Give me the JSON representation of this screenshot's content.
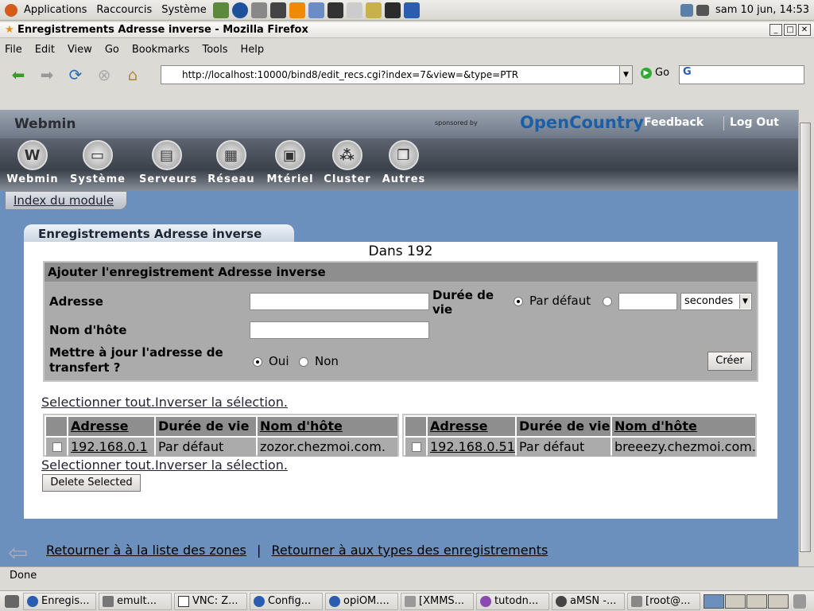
{
  "panel": {
    "menus": [
      "Applications",
      "Raccourcis",
      "Système"
    ],
    "clock": "sam 10 jun, 14:53"
  },
  "window": {
    "title": "Enregistrements Adresse inverse - Mozilla Firefox"
  },
  "menubar": [
    "File",
    "Edit",
    "View",
    "Go",
    "Bookmarks",
    "Tools",
    "Help"
  ],
  "nav": {
    "url": "http://localhost:10000/bind8/edit_recs.cgi?index=7&view=&type=PTR",
    "go_label": "Go"
  },
  "webmin": {
    "logo": "Webmin",
    "sponsor": "sponsored by",
    "oc_logo": "OpenCountry",
    "feedback": "Feedback",
    "logout": "Log Out",
    "categories": [
      "Webmin",
      "Système",
      "Serveurs",
      "Réseau",
      "Mtériel",
      "Cluster",
      "Autres"
    ],
    "module_index": "Index du module"
  },
  "page": {
    "tab_title": "Enregistrements Adresse inverse",
    "heading": "Dans 192",
    "add": {
      "title": "Ajouter l'enregistrement Adresse inverse",
      "address_label": "Adresse",
      "ttl_label": "Durée de vie",
      "ttl_default": "Par défaut",
      "ttl_unit": "secondes",
      "hostname_label": "Nom d'hôte",
      "update_label": "Mettre à jour l'adresse de transfert ?",
      "yes": "Oui",
      "no": "Non",
      "create": "Créer"
    },
    "select_all": "Selectionner tout.",
    "invert": "Inverser la sélection.",
    "headers": [
      "Adresse",
      "Durée de vie",
      "Nom d'hôte"
    ],
    "rows": [
      {
        "address": "192.168.0.1",
        "ttl": "Par défaut",
        "host": "zozor.chezmoi.com."
      },
      {
        "address": "192.168.0.51",
        "ttl": "Par défaut",
        "host": "breeezy.chezmoi.com."
      }
    ],
    "delete": "Delete Selected",
    "footer_link1": "Retourner à à la liste des zones",
    "footer_sep": "|",
    "footer_link2": "Retourner à aux types des enregistrements"
  },
  "status": "Done",
  "taskbar": [
    "Enregis...",
    "emult...",
    "VNC: Z...",
    "Config...",
    "opiOM....",
    "[XMMS...",
    "tutodn...",
    "aMSN -...",
    "[root@..."
  ]
}
